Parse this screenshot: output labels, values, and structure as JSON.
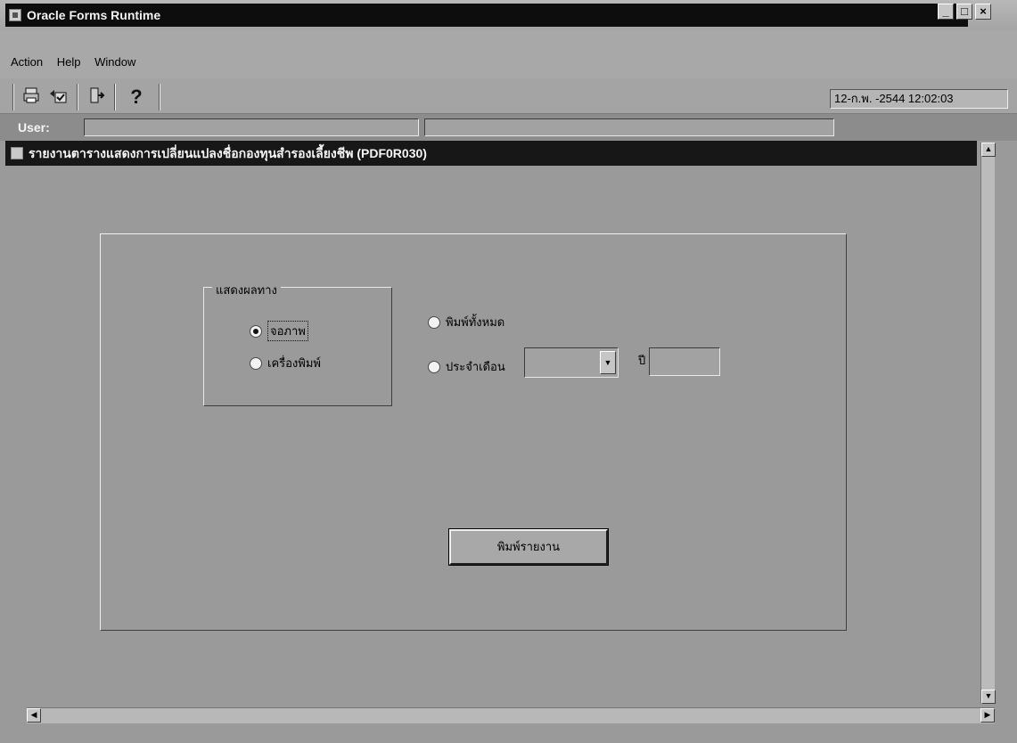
{
  "window": {
    "title": "Oracle Forms Runtime",
    "buttons": {
      "minimize": "_",
      "restore": "□",
      "close": "×"
    }
  },
  "menu": [
    {
      "label": "Action"
    },
    {
      "label": "Help"
    },
    {
      "label": "Window"
    }
  ],
  "toolbar": {
    "icons": [
      "print-icon",
      "print-setup-icon",
      "exit-icon",
      "help-icon"
    ],
    "help_glyph": "?",
    "datetime": "12-ก.พ. -2544 12:02:03"
  },
  "user": {
    "label": "User:",
    "value": ""
  },
  "form": {
    "title": "รายงานตารางแสดงการเปลี่ยนแปลงชื่อกองทุนสำรองเลี้ยงชีพ (PDF0R030)",
    "output_group": {
      "label": "แสดงผลทาง",
      "options": [
        {
          "label": "จอภาพ",
          "selected": true
        },
        {
          "label": "เครื่องพิมพ์",
          "selected": false
        }
      ]
    },
    "scope_options": [
      {
        "label": "พิมพ์ทั้งหมด",
        "selected": false
      },
      {
        "label": "ประจำเดือน",
        "selected": false
      }
    ],
    "month_value": "",
    "year_label": "ปี",
    "year_value": "",
    "print_button": "พิมพ์รายงาน"
  }
}
